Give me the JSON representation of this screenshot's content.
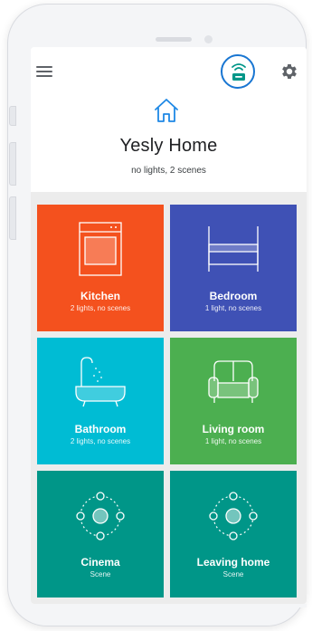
{
  "home": {
    "title": "Yesly Home",
    "subtitle": "no lights, 2 scenes"
  },
  "toolbar": {
    "menu_icon": "menu-icon",
    "hub_icon": "hub-router-icon",
    "settings_icon": "gear-icon",
    "accent_color": "#1976d2"
  },
  "rooms": [
    {
      "name": "Kitchen",
      "subtitle": "2 lights, no scenes",
      "icon": "oven-icon",
      "color": "#f4511e"
    },
    {
      "name": "Bedroom",
      "subtitle": "1 light, no scenes",
      "icon": "bed-icon",
      "color": "#3f51b5"
    },
    {
      "name": "Bathroom",
      "subtitle": "2 lights, no scenes",
      "icon": "bathtub-icon",
      "color": "#00bcd4"
    },
    {
      "name": "Living room",
      "subtitle": "1 light, no scenes",
      "icon": "sofa-icon",
      "color": "#4caf50"
    },
    {
      "name": "Cinema",
      "subtitle": "Scene",
      "icon": "scene-icon",
      "color": "#009688"
    },
    {
      "name": "Leaving home",
      "subtitle": "Scene",
      "icon": "scene-icon",
      "color": "#009688"
    }
  ]
}
